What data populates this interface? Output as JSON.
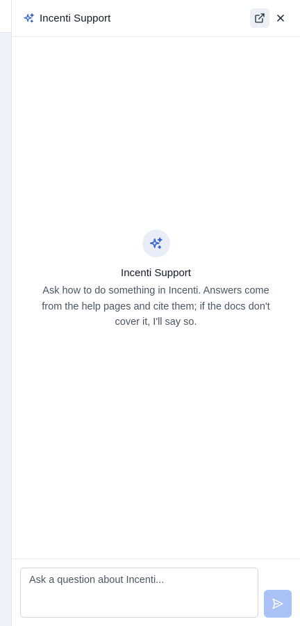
{
  "header": {
    "title": "Incenti Support",
    "icons": {
      "brand": "sparkles-icon",
      "popout": "external-link-icon",
      "close": "close-icon"
    }
  },
  "empty_state": {
    "icon": "sparkles-icon",
    "title": "Incenti Support",
    "description": "Ask how to do something in Incenti. Answers come from the help pages and cite them; if the docs don't cover it, I'll say so."
  },
  "composer": {
    "placeholder": "Ask a question about Incenti...",
    "value": "",
    "send_icon": "send-icon"
  },
  "colors": {
    "accent": "#2f5fd0",
    "send_button_disabled": "#a9c1f5",
    "empty_icon_bg": "#e8edf7",
    "text_primary": "#111827",
    "text_secondary": "#4b5563"
  }
}
